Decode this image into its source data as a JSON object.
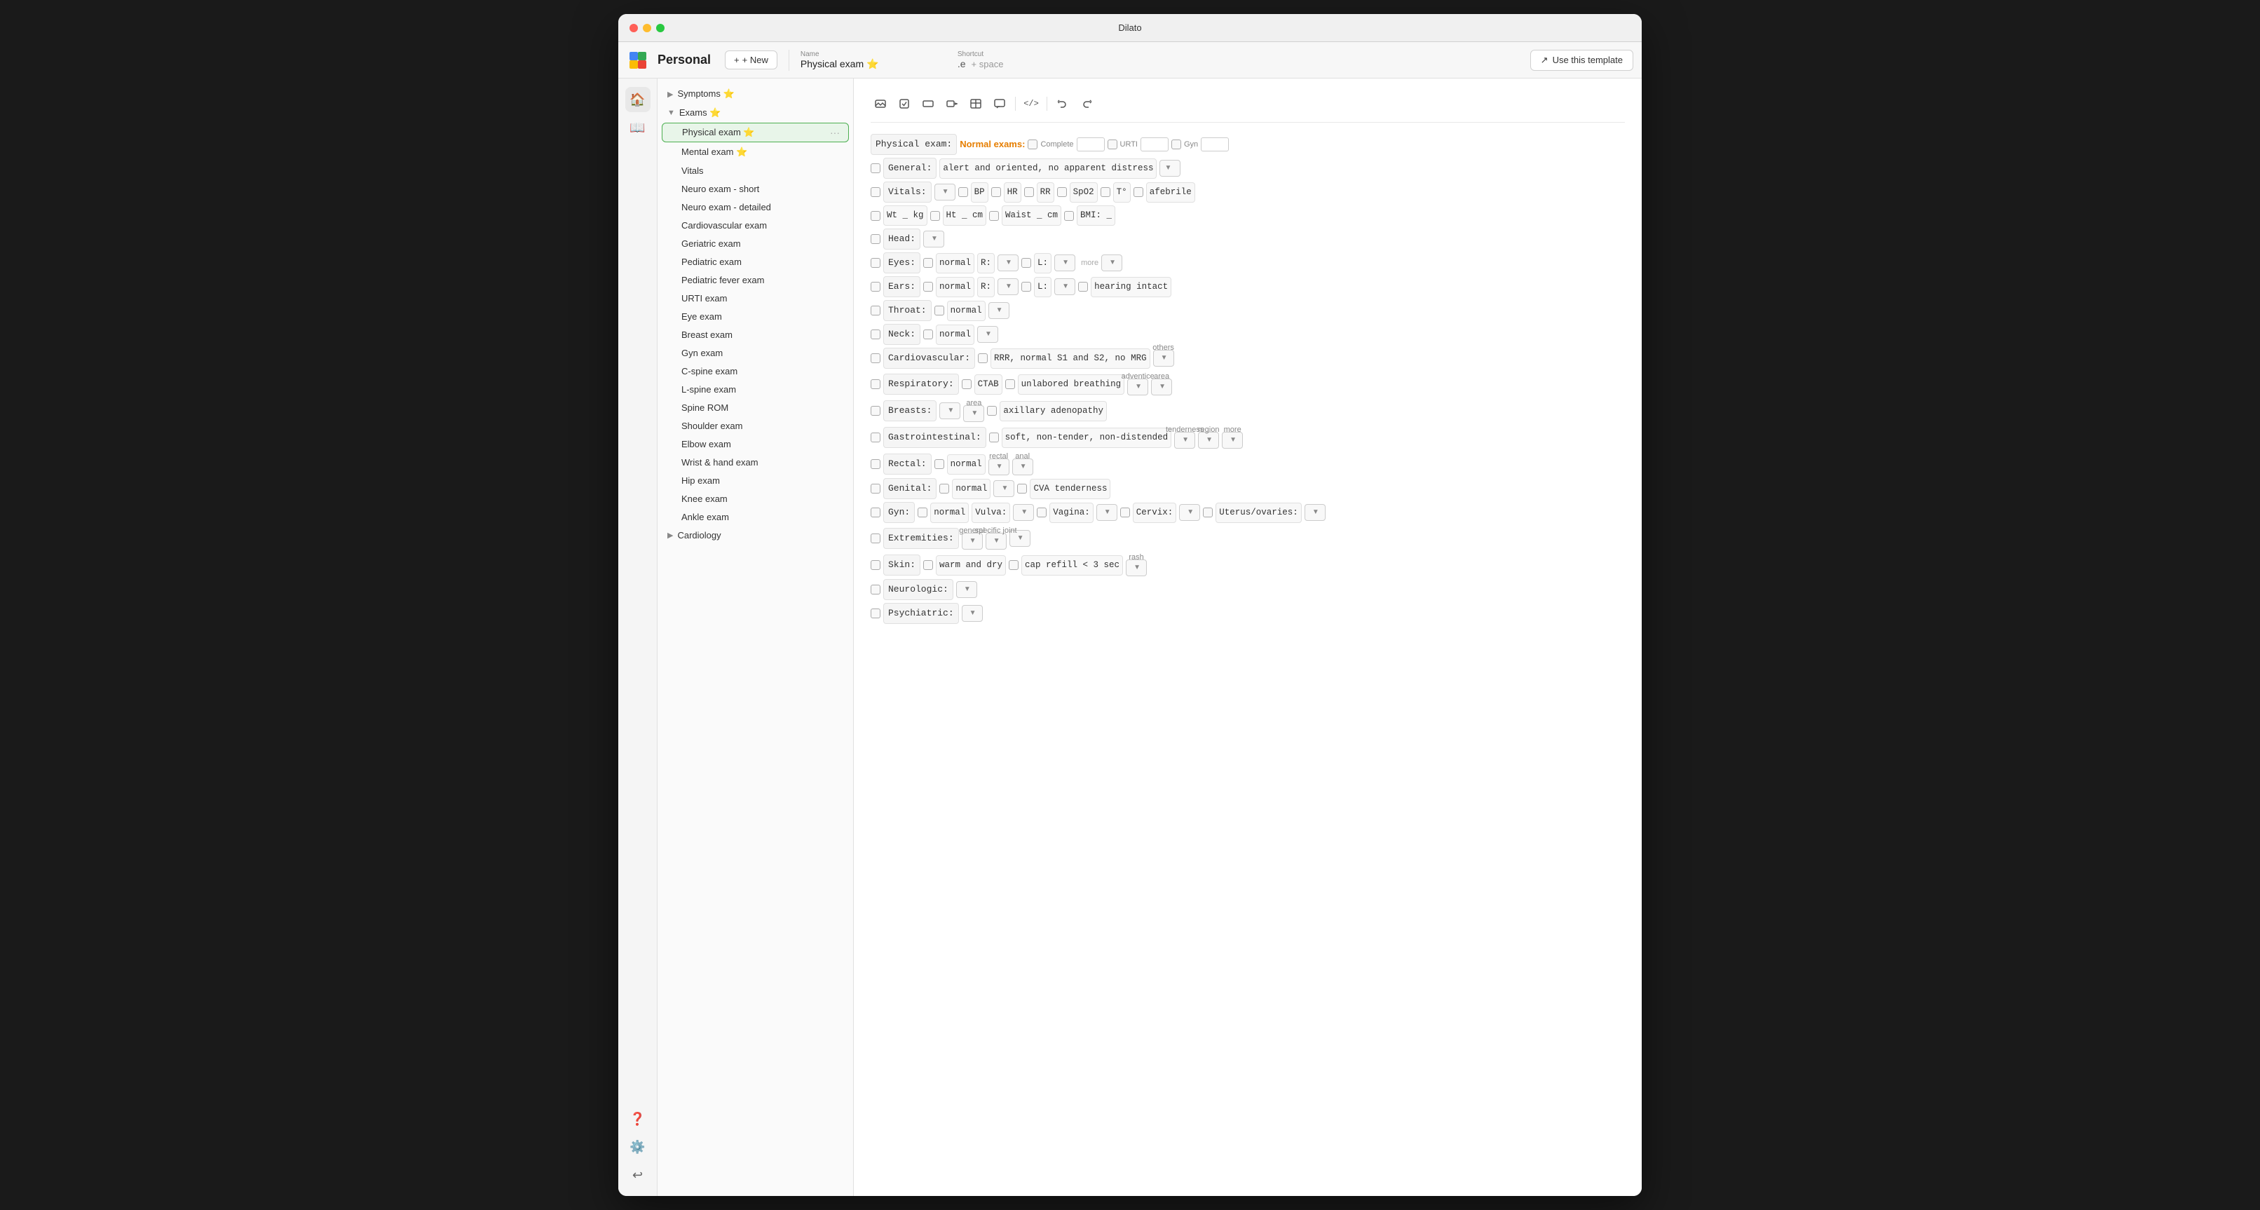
{
  "window": {
    "title": "Dilato"
  },
  "toolbar": {
    "brand": "Personal",
    "new_label": "+ New",
    "name_label": "Name",
    "name_value": "Physical exam ⭐",
    "shortcut_label": "Shortcut",
    "shortcut_value": ".e",
    "shortcut_space": "+ space",
    "use_template_label": "Use this template"
  },
  "sidebar": {
    "sections": [
      {
        "label": "Symptoms ⭐",
        "expanded": false,
        "items": []
      },
      {
        "label": "Exams ⭐",
        "expanded": true,
        "items": [
          "Physical exam ⭐",
          "Mental exam ⭐",
          "Vitals",
          "Neuro exam - short",
          "Neuro exam - detailed",
          "Cardiovascular exam",
          "Geriatric exam",
          "Pediatric exam",
          "Pediatric fever exam",
          "URTI exam",
          "Eye exam",
          "Breast exam",
          "Gyn exam",
          "C-spine exam",
          "L-spine exam",
          "Spine ROM",
          "Shoulder exam",
          "Elbow exam",
          "Wrist & hand exam",
          "Hip exam",
          "Knee exam",
          "Ankle exam"
        ]
      },
      {
        "label": "Cardiology",
        "expanded": false,
        "items": []
      }
    ]
  },
  "template": {
    "rows": [
      {
        "type": "header",
        "label": "Physical exam:",
        "normal_exams": "Normal exams:",
        "groups": [
          "Complete",
          "URTI",
          "Gyn"
        ]
      },
      {
        "type": "general",
        "label": "General:",
        "value": "alert and oriented, no apparent distress",
        "has_dropdown": true
      },
      {
        "type": "vitals",
        "label": "Vitals:",
        "fields": [
          "BP",
          "HR",
          "RR",
          "SpO2",
          "T°",
          "afebrile"
        ]
      },
      {
        "type": "weight",
        "fields": [
          "Wt _ kg",
          "Ht _ cm",
          "Waist _ cm",
          "BMI: _"
        ]
      },
      {
        "type": "head",
        "label": "Head:",
        "has_dropdown": true
      },
      {
        "type": "eyes",
        "label": "Eyes:",
        "value": "normal",
        "r_label": "R:",
        "l_label": "L:",
        "more_label": "more"
      },
      {
        "type": "ears",
        "label": "Ears:",
        "value": "normal",
        "r_label": "R:",
        "l_label": "L:",
        "extra": "hearing intact"
      },
      {
        "type": "throat",
        "label": "Throat:",
        "value": "normal",
        "has_dropdown": true
      },
      {
        "type": "neck",
        "label": "Neck:",
        "value": "normal",
        "has_dropdown": true
      },
      {
        "type": "cardiovascular",
        "label": "Cardiovascular:",
        "value": "RRR, normal S1 and S2, no MRG",
        "others": "others"
      },
      {
        "type": "respiratory",
        "label": "Respiratory:",
        "value": "CTAB",
        "extra": "unlabored breathing",
        "adventice": "adventice",
        "area": "area"
      },
      {
        "type": "breasts",
        "label": "Breasts:",
        "area": "area",
        "extra": "axillary adenopathy"
      },
      {
        "type": "gastrointestinal",
        "label": "Gastrointestinal:",
        "value": "soft, non-tender, non-distended",
        "tenderness": "tenderness",
        "region": "region",
        "more": "more"
      },
      {
        "type": "rectal",
        "label": "Rectal:",
        "value": "normal",
        "rectal_dd": "rectal",
        "anal_dd": "anal"
      },
      {
        "type": "genital",
        "label": "Genital:",
        "value": "normal",
        "extra": "CVA tenderness"
      },
      {
        "type": "gyn",
        "label": "Gyn:",
        "value": "normal",
        "vulva": "Vulva:",
        "vagina": "Vagina:",
        "cervix": "Cervix:",
        "uterus": "Uterus/ovaries:"
      },
      {
        "type": "extremities",
        "label": "Extremities:",
        "general": "general",
        "specific_joint": "specific joint"
      },
      {
        "type": "skin",
        "label": "Skin:",
        "value": "warm and dry",
        "extra": "cap refill < 3 sec",
        "rash": "rash"
      },
      {
        "type": "neurologic",
        "label": "Neurologic:",
        "has_dropdown": true
      },
      {
        "type": "psychiatric",
        "label": "Psychiatric:",
        "has_dropdown": true
      }
    ]
  },
  "icons": {
    "home": "🏠",
    "book": "📖",
    "help": "❓",
    "settings": "⚙️",
    "logout": "↩️",
    "new_plus": "+",
    "arrow_right": "▶",
    "arrow_down": "▼",
    "dots": "···"
  }
}
